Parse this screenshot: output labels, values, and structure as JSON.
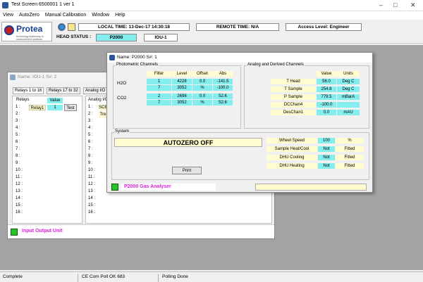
{
  "window": {
    "title": "Test Screen 6500001 1 ver 1",
    "controls": [
      "–",
      "□",
      "✕"
    ]
  },
  "menu": [
    "View",
    "AutoZero",
    "Manual Calibration",
    "Window",
    "Help"
  ],
  "logo": {
    "name": "Protea",
    "tagline": "technology leadership in measurement solutions"
  },
  "toolbar": {
    "local_time": "LOCAL TIME: 13-Dec-17 14:30:18",
    "remote_time": "REMOTE TIME: N/A",
    "access_level": "Access Level: Engineer",
    "head_status_label": "HEAD STATUS :",
    "head_status_value": "P2000",
    "unit": "IOU-1"
  },
  "back_window": {
    "title": "Name: IOU-1 S#: 2",
    "tabs": [
      "Relays 1 to 16",
      "Relays 17 to 32",
      "Analog I/O"
    ],
    "relays_header": "Relays",
    "value_header": "Value",
    "relay1_name": "Relay1",
    "relay1_value": "1",
    "test_label": "Test",
    "analog_header": "Analog I/O",
    "analog_items": [
      "SCE",
      "Tre"
    ],
    "rows": [
      "1 :",
      "2 :",
      "3 :",
      "4 :",
      "5 :",
      "6 :",
      "7 :",
      "8 :",
      "9 :",
      "10 :",
      "11 :",
      "12 :",
      "13 :",
      "14 :",
      "15 :",
      "16 :"
    ],
    "footer": "Input Output Unit"
  },
  "front_window": {
    "title": "Name: P2000 S#: 1",
    "photometric": {
      "label": "Photometric Channels",
      "headers": [
        "Filter",
        "Level",
        "Offset",
        "Abs"
      ],
      "groups": [
        {
          "name": "H2O",
          "rows": [
            [
              "1",
              "4228",
              "0.0",
              "-141.5"
            ],
            [
              "7",
              "3052",
              "%",
              "-100.0"
            ]
          ]
        },
        {
          "name": "CO2",
          "rows": [
            [
              "2",
              "2698",
              "0.0",
              "52.6"
            ],
            [
              "7",
              "3052",
              "%",
              "52.6"
            ]
          ]
        }
      ]
    },
    "analog": {
      "label": "Analog and Derived Channels",
      "headers": [
        "Value",
        "Units"
      ],
      "rows": [
        [
          "T Head",
          "56.0",
          "Deg C"
        ],
        [
          "T Sample",
          "254.8",
          "Deg C"
        ],
        [
          "P Sample",
          "779.5",
          "mBarA"
        ],
        [
          "DCChan4",
          "-100.0",
          ""
        ],
        [
          "DesChan1",
          "0.0",
          "mAU"
        ]
      ]
    },
    "system": {
      "label": "System",
      "autozero": "AUTOZERO OFF",
      "print_label": "Print",
      "rows": [
        [
          "Wheel Speed",
          "100",
          "%"
        ],
        [
          "Sample Heat/Cool",
          "Not",
          "Fitted"
        ],
        [
          "DHU Cooling",
          "Not",
          "Fitted"
        ],
        [
          "DHU Heating",
          "Not",
          "Fitted"
        ]
      ]
    },
    "footer": "P2000 Gas Analyser"
  },
  "status": {
    "left": "Complete",
    "mid": "CE Com Poll OK 683",
    "right": "Polling Done"
  },
  "colors": {
    "cyan": "#84eeee",
    "yellow": "#fffccf",
    "magenta": "#e020e0",
    "green": "#27c427"
  }
}
